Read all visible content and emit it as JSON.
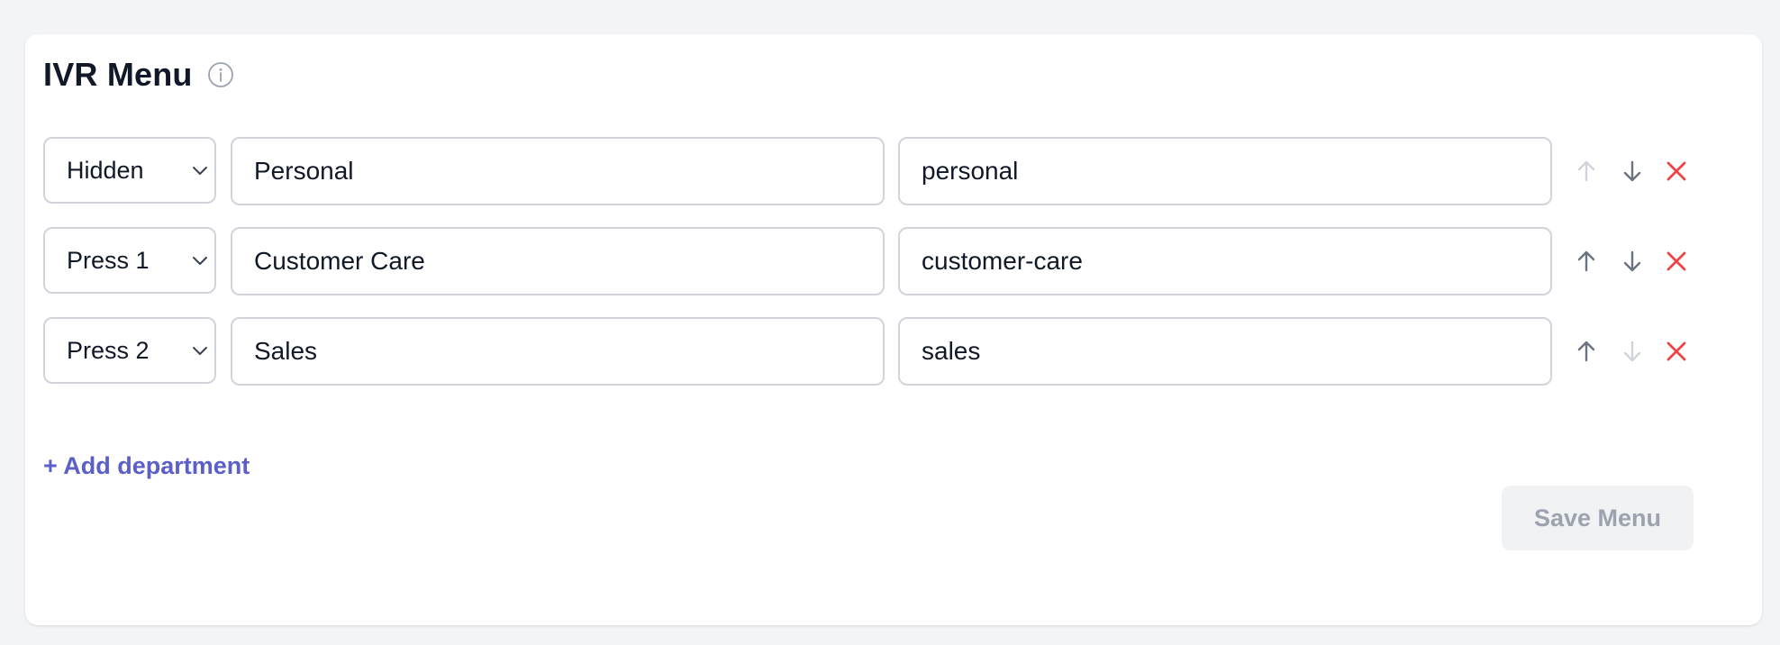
{
  "header": {
    "title": "IVR Menu"
  },
  "rows": [
    {
      "option": "Hidden",
      "name": "Personal",
      "slug": "personal",
      "up_enabled": false,
      "down_enabled": true
    },
    {
      "option": "Press 1",
      "name": "Customer Care",
      "slug": "customer-care",
      "up_enabled": true,
      "down_enabled": true
    },
    {
      "option": "Press 2",
      "name": "Sales",
      "slug": "sales",
      "up_enabled": true,
      "down_enabled": false
    }
  ],
  "add_department_label": "+ Add department",
  "save_label": "Save Menu",
  "icons": {
    "info": "info-circle-icon",
    "chevron": "chevron-down-icon",
    "up": "arrow-up-icon",
    "down": "arrow-down-icon",
    "delete": "close-icon"
  },
  "colors": {
    "accent": "#5b5fc7",
    "danger": "#ef4444",
    "arrow_enabled": "#6b7280",
    "arrow_disabled": "#d1d5db",
    "save_bg": "#f1f2f4",
    "save_text": "#9ca3af"
  }
}
